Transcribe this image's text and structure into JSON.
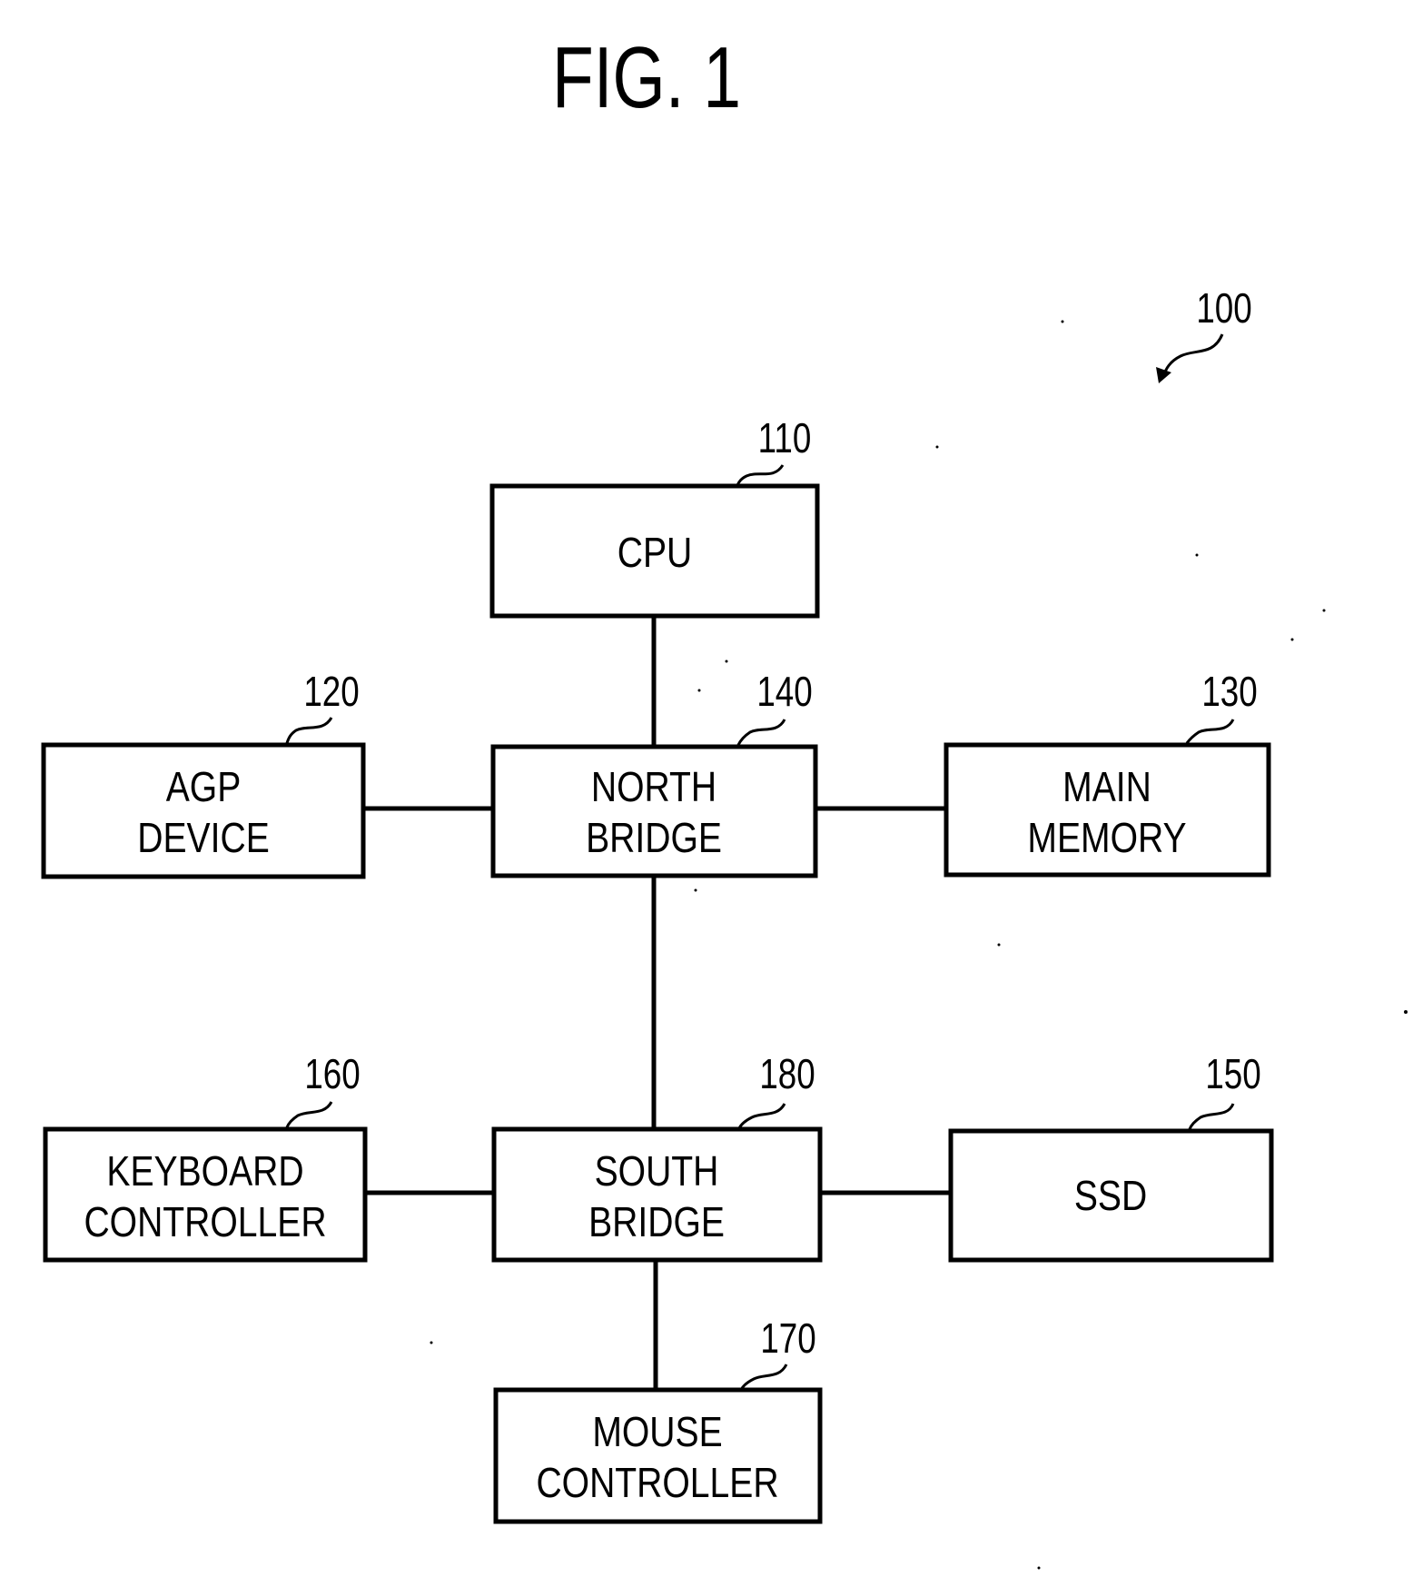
{
  "figure": {
    "title": "FIG. 1",
    "system_ref": "100"
  },
  "blocks": [
    {
      "id": "cpu",
      "ref": "110",
      "lines": [
        "CPU"
      ]
    },
    {
      "id": "agp",
      "ref": "120",
      "lines": [
        "AGP",
        "DEVICE"
      ]
    },
    {
      "id": "north-bridge",
      "ref": "140",
      "lines": [
        "NORTH",
        "BRIDGE"
      ]
    },
    {
      "id": "main-memory",
      "ref": "130",
      "lines": [
        "MAIN",
        "MEMORY"
      ]
    },
    {
      "id": "keyboard-controller",
      "ref": "160",
      "lines": [
        "KEYBOARD",
        "CONTROLLER"
      ]
    },
    {
      "id": "south-bridge",
      "ref": "180",
      "lines": [
        "SOUTH",
        "BRIDGE"
      ]
    },
    {
      "id": "ssd",
      "ref": "150",
      "lines": [
        "SSD"
      ]
    },
    {
      "id": "mouse-controller",
      "ref": "170",
      "lines": [
        "MOUSE",
        "CONTROLLER"
      ]
    }
  ],
  "connections": [
    [
      "cpu",
      "north-bridge"
    ],
    [
      "agp",
      "north-bridge"
    ],
    [
      "north-bridge",
      "main-memory"
    ],
    [
      "north-bridge",
      "south-bridge"
    ],
    [
      "keyboard-controller",
      "south-bridge"
    ],
    [
      "south-bridge",
      "ssd"
    ],
    [
      "south-bridge",
      "mouse-controller"
    ]
  ]
}
